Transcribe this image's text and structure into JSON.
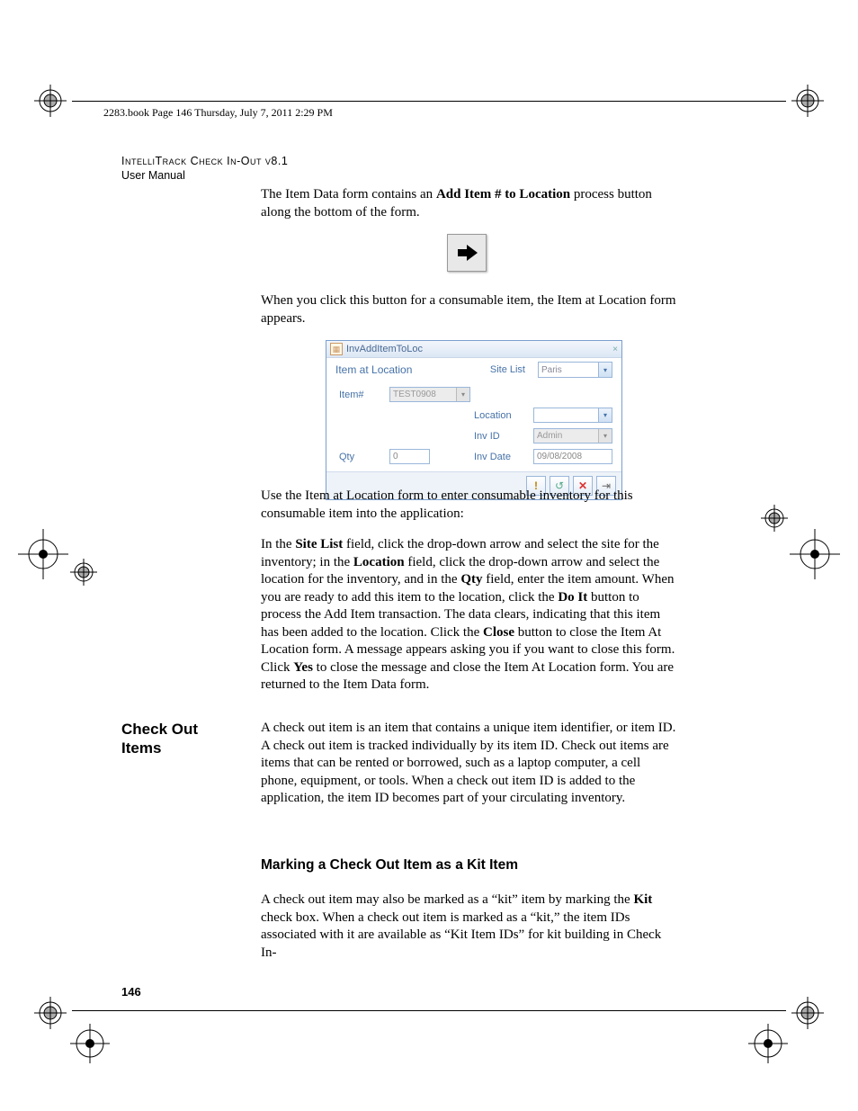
{
  "header": {
    "book_line": "2283.book  Page 146  Thursday, July 7, 2011  2:29 PM",
    "title": "IntelliTrack Check In-Out v8.1",
    "subtitle": "User Manual"
  },
  "paragraphs": {
    "p1_a": "The Item Data form contains an ",
    "p1_b": "Add Item # to Location",
    "p1_c": " process button along the bottom of the form.",
    "p2": "When you click this button for a consumable item, the Item at Location form appears.",
    "p3": "Use the Item at Location form to enter consumable inventory for this consumable item into the application:",
    "p4_a": "In the ",
    "p4_b": "Site List",
    "p4_c": " field, click the drop-down arrow and select the site for the inventory; in the ",
    "p4_d": "Location",
    "p4_e": " field, click the drop-down arrow and select the location for the inventory, and in the ",
    "p4_f": "Qty",
    "p4_g": " field, enter the item amount. When you are ready to add this item to the location, click the ",
    "p4_h": "Do It",
    "p4_i": " button to process the Add Item transaction. The data clears, indicating that this item has been added to the location. Click the ",
    "p4_j": "Close",
    "p4_k": " button to close the Item At Location form. A message appears asking you if you want to close this form. Click ",
    "p4_l": "Yes",
    "p4_m": " to close the message and close the Item At Location form. You are returned to the Item Data form.",
    "p5": "A check out item is an item that contains a unique item identifier, or item ID. A check out item is tracked individually by its item ID. Check out items are items that can be rented or borrowed, such as a laptop computer, a cell phone, equipment, or tools. When a check out item ID is added to the application, the item ID becomes part of your circulating inventory.",
    "p6_a": "A check out item may also be marked as a “kit” item by marking the ",
    "p6_b": "Kit",
    "p6_c": " check box. When a check out item is marked as a “kit,” the item IDs associated with it are available as “Kit Item IDs” for kit building in Check In-"
  },
  "section_label": "Check Out Items",
  "heading2": "Marking a Check Out Item as a Kit Item",
  "page_number": "146",
  "form": {
    "window_title": "InvAddItemToLoc",
    "form_title": "Item at Location",
    "site_list_label": "Site List",
    "site_list_value": "Paris",
    "item_label": "Item#",
    "item_value": "TEST0908",
    "location_label": "Location",
    "location_value": "",
    "invid_label": "Inv ID",
    "invid_value": "Admin",
    "qty_label": "Qty",
    "qty_value": "0",
    "invdate_label": "Inv Date",
    "invdate_value": "09/08/2008"
  }
}
